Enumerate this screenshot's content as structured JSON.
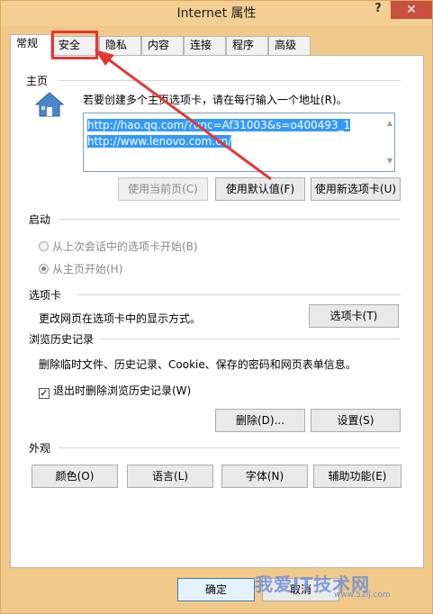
{
  "window": {
    "title": "Internet 属性",
    "help_symbol": "?",
    "close_symbol": "✕"
  },
  "tabs": [
    {
      "label": "常规"
    },
    {
      "label": "安全"
    },
    {
      "label": "隐私"
    },
    {
      "label": "内容"
    },
    {
      "label": "连接"
    },
    {
      "label": "程序"
    },
    {
      "label": "高级"
    }
  ],
  "home": {
    "section_label": "主页",
    "description": "若要创建多个主页选项卡，请在每行输入一个地址(R)。",
    "urls": [
      "http://hao.qq.com/?unc=Af31003&s=o400493_1",
      "http://www.lenovo.com.cn/"
    ],
    "buttons": {
      "use_current": "使用当前页(C)",
      "use_default": "使用默认值(F)",
      "use_new_tab": "使用新选项卡(U)"
    }
  },
  "startup": {
    "section_label": "启动",
    "option_last_session": "从上次会话中的选项卡开始(B)",
    "option_home": "从主页开始(H)"
  },
  "tabs_section": {
    "section_label": "选项卡",
    "description": "更改网页在选项卡中的显示方式。",
    "button": "选项卡(T)"
  },
  "history": {
    "section_label": "浏览历史记录",
    "description": "删除临时文件、历史记录、Cookie、保存的密码和网页表单信息。",
    "checkbox_label": "退出时删除浏览历史记录(W)",
    "checkbox_mark": "✓",
    "delete_button": "删除(D)...",
    "settings_button": "设置(S)"
  },
  "appearance": {
    "section_label": "外观",
    "colors_button": "颜色(O)",
    "languages_button": "语言(L)",
    "fonts_button": "字体(N)",
    "accessibility_button": "辅助功能(E)"
  },
  "footer": {
    "ok_button": "确定",
    "cancel_button": "取消"
  },
  "overlay": {
    "watermark": "我爱IT技术网",
    "watermark_url": "www.52ij.com"
  }
}
